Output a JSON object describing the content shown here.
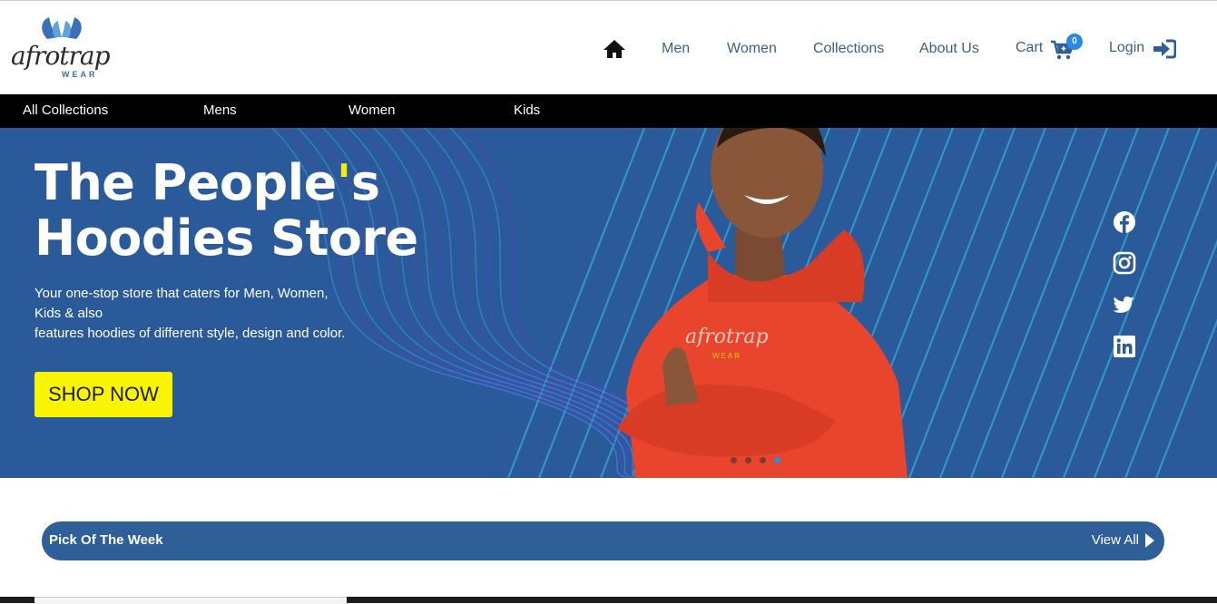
{
  "brand": {
    "logo_text": "afrotrap",
    "logo_sub": "WEAR"
  },
  "header": {
    "nav_items": [
      "Men",
      "Women",
      "Collections",
      "About Us"
    ],
    "cart_label": "Cart",
    "cart_count": "0",
    "login_label": "Login",
    "icons": [
      "home-icon",
      "cart-icon",
      "login-icon"
    ]
  },
  "subnav": {
    "items": [
      "All Collections",
      "Mens",
      "Women",
      "Kids"
    ]
  },
  "hero": {
    "title_line1_a": "The People",
    "title_line1_apos": "'",
    "title_line1_b": "s",
    "title_line2": "Hoodies Store",
    "desc_line1": "Your one-stop store that caters for Men, Women,",
    "desc_line2": "Kids & also",
    "desc_line3": "features hoodies of different style, design and color.",
    "cta": "SHOP NOW",
    "hoodie_print": "afrotrap",
    "hoodie_print_sub": "WEAR",
    "social_icons": [
      "facebook-icon",
      "instagram-icon",
      "twitter-icon",
      "linkedin-icon"
    ],
    "carousel_dots": 4,
    "active_dot": 4
  },
  "pick": {
    "title": "Pick Of The Week",
    "view_all": "View All"
  },
  "colors": {
    "hero_bg": "#2b5a9b",
    "accent_yellow": "#f9f500",
    "nav_text": "#3d5f85",
    "badge": "#2a8be6",
    "pick_bar": "#2f5f99"
  }
}
